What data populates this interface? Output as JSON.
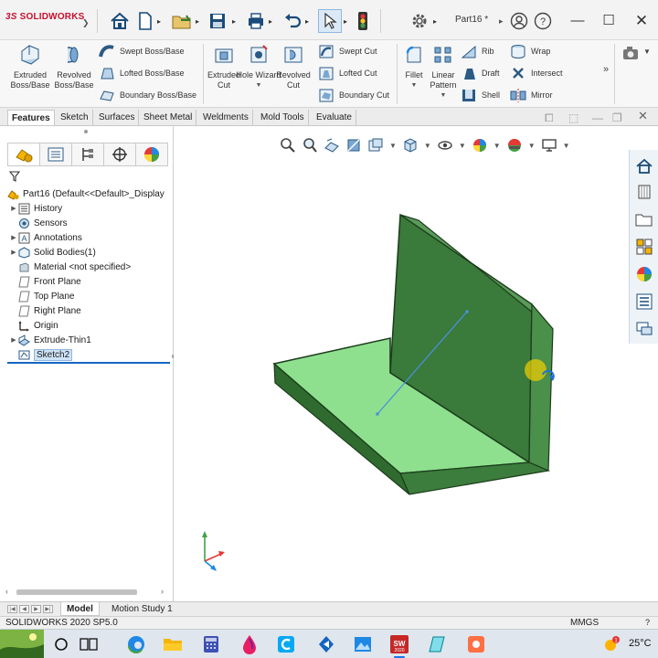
{
  "app": {
    "logo_prefix": "3S",
    "logo_text": "SOLIDWORKS",
    "doc_title": "Part16 *"
  },
  "ribbon": {
    "extruded_boss": "Extruded Boss/Base",
    "revolved_boss": "Revolved Boss/Base",
    "swept_boss": "Swept Boss/Base",
    "lofted_boss": "Lofted Boss/Base",
    "boundary_boss": "Boundary Boss/Base",
    "extruded_cut": "Extruded Cut",
    "hole_wizard": "Hole Wizard",
    "revolved_cut": "Revolved Cut",
    "swept_cut": "Swept Cut",
    "lofted_cut": "Lofted Cut",
    "boundary_cut": "Boundary Cut",
    "fillet": "Fillet",
    "linear_pattern": "Linear Pattern",
    "rib": "Rib",
    "draft": "Draft",
    "shell": "Shell",
    "wrap": "Wrap",
    "intersect": "Intersect",
    "mirror": "Mirror"
  },
  "tabs": [
    "Features",
    "Sketch",
    "Surfaces",
    "Sheet Metal",
    "Weldments",
    "Mold Tools",
    "Evaluate"
  ],
  "tree": {
    "root": "Part16  (Default<<Default>_Display",
    "items": [
      {
        "label": "History"
      },
      {
        "label": "Sensors"
      },
      {
        "label": "Annotations"
      },
      {
        "label": "Solid Bodies(1)"
      },
      {
        "label": "Material <not specified>"
      },
      {
        "label": "Front Plane"
      },
      {
        "label": "Top Plane"
      },
      {
        "label": "Right Plane"
      },
      {
        "label": "Origin"
      },
      {
        "label": "Extrude-Thin1"
      },
      {
        "label": "Sketch2"
      }
    ]
  },
  "bottom_tabs": [
    "Model",
    "Motion Study 1"
  ],
  "status": {
    "version": "SOLIDWORKS 2020 SP5.0",
    "units": "MMGS"
  },
  "taskbar": {
    "notification_count": "1",
    "temperature": "25°C"
  },
  "colors": {
    "model_top": "#8ee08e",
    "model_dark": "#2f6b2f",
    "model_wall": "#3f7d3f",
    "accent": "#1565c0",
    "brand": "#c8102e"
  }
}
